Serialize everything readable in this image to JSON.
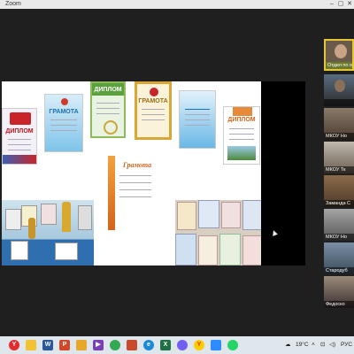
{
  "window": {
    "title": "Zoom"
  },
  "share": {
    "docs": [
      {
        "id": "diploma-left",
        "title": "ДИПЛОМ",
        "color": "#b8161b"
      },
      {
        "id": "gramota-blue",
        "title": "ГРАМОТА",
        "color": "#1a6fb5"
      },
      {
        "id": "diploma-green",
        "title": "ДИПЛОМ",
        "color": "#2a8a3a"
      },
      {
        "id": "gramota-gold",
        "title": "ГРАМОТА",
        "color": "#9a6d14"
      },
      {
        "id": "certificate-blue",
        "title": "",
        "color": "#1a6fb5"
      },
      {
        "id": "diploma-orange",
        "title": "ДИПЛОМ",
        "color": "#d4641a"
      },
      {
        "id": "gramota-center",
        "title": "Грамота",
        "color": "#d4641a"
      }
    ]
  },
  "participants": [
    {
      "name": "Отдел по обр",
      "highlight": true
    },
    {
      "name": ""
    },
    {
      "name": "МКОУ Но"
    },
    {
      "name": "МКОУ Тк"
    },
    {
      "name": "Заманда С"
    },
    {
      "name": "МКОУ Но"
    },
    {
      "name": "Стародуб"
    },
    {
      "name": "Федоско"
    }
  ],
  "taskbar": {
    "weather": "19°C",
    "lang": "РУС",
    "icons": [
      "yandex",
      "explorer",
      "word",
      "powerpoint",
      "files",
      "media",
      "chrome",
      "images",
      "edge",
      "excel",
      "viber",
      "yandex-browser",
      "zoom",
      "whatsapp"
    ]
  }
}
